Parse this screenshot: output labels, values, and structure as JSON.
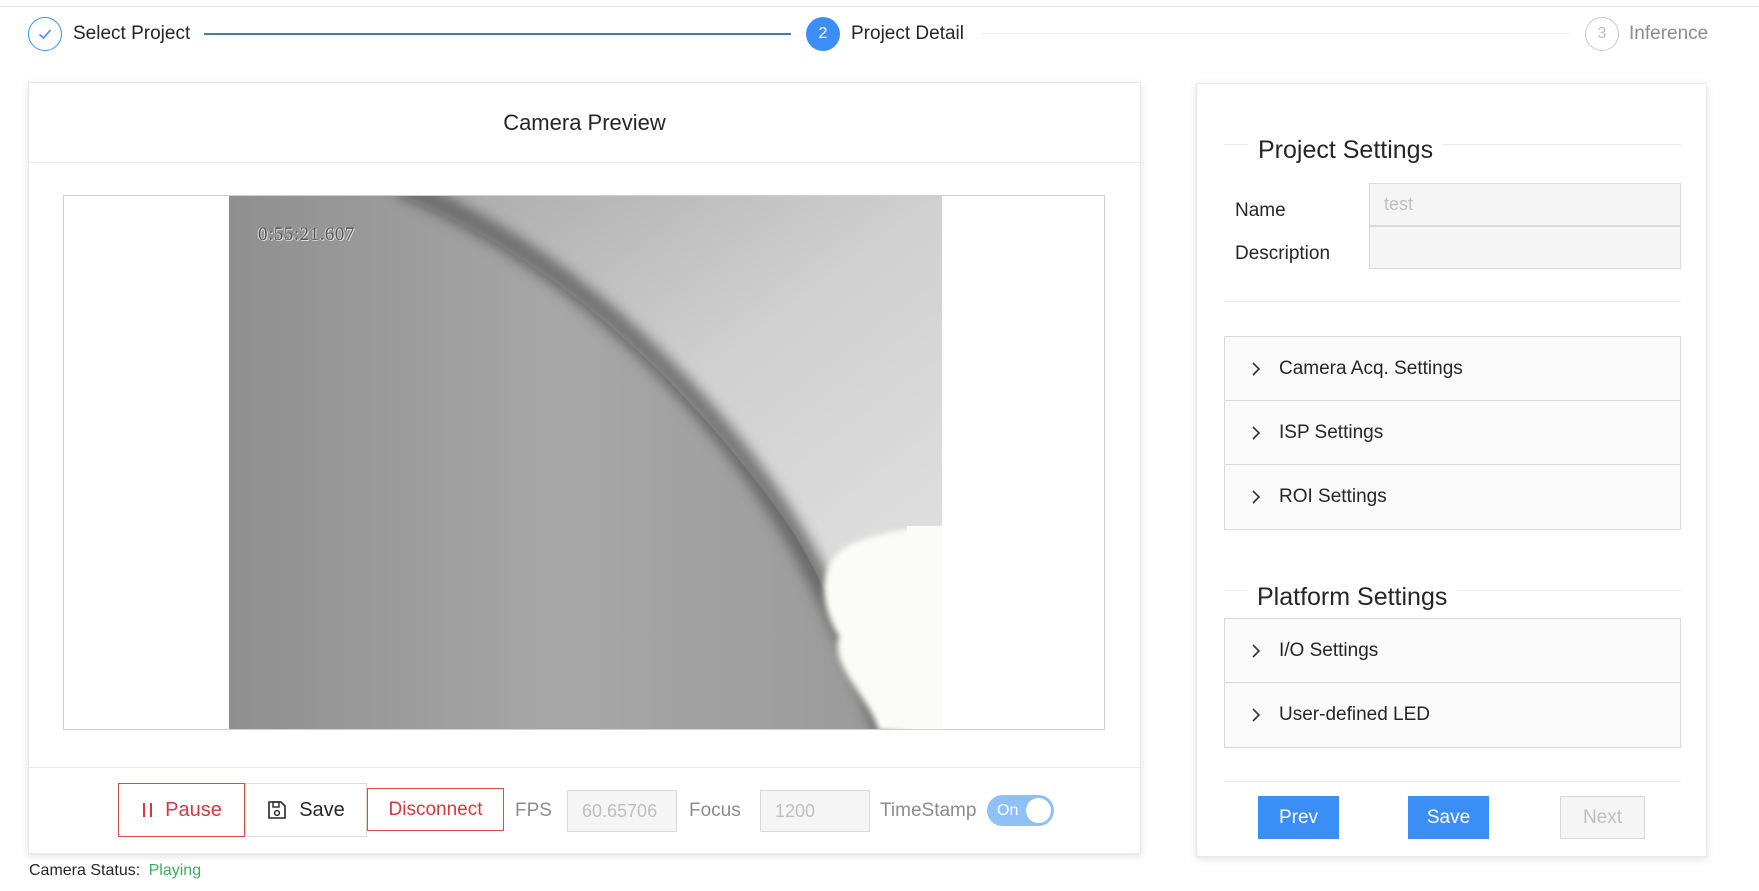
{
  "steps": [
    {
      "label": "Select Project",
      "status": "finish",
      "icon": "check-icon"
    },
    {
      "label": "Project Detail",
      "number": "2",
      "status": "process"
    },
    {
      "label": "Inference",
      "number": "3",
      "status": "wait"
    }
  ],
  "preview": {
    "title": "Camera Preview",
    "timestamp_overlay": "0:55:21.607"
  },
  "controls": {
    "pause_label": "Pause",
    "save_label": "Save",
    "disconnect_label": "Disconnect",
    "fps_label": "FPS",
    "fps_value": "60.65706",
    "focus_label": "Focus",
    "focus_value": "1200",
    "timestamp_label": "TimeStamp",
    "timestamp_toggle_text": "On",
    "timestamp_toggle_on": true
  },
  "camera_status": {
    "label": "Camera Status:",
    "value": "Playing"
  },
  "project_settings": {
    "title": "Project Settings",
    "name_label": "Name",
    "name_placeholder": "test",
    "description_label": "Description",
    "description_value": "",
    "sections": [
      {
        "label": "Camera Acq. Settings"
      },
      {
        "label": "ISP Settings"
      },
      {
        "label": "ROI Settings"
      }
    ]
  },
  "platform_settings": {
    "title": "Platform Settings",
    "sections": [
      {
        "label": "I/O Settings"
      },
      {
        "label": "User-defined LED"
      }
    ]
  },
  "nav": {
    "prev_label": "Prev",
    "save_label": "Save",
    "next_label": "Next"
  },
  "colors": {
    "primary": "#3a8ef5",
    "danger": "#d9363e",
    "success": "#3dab5f"
  }
}
